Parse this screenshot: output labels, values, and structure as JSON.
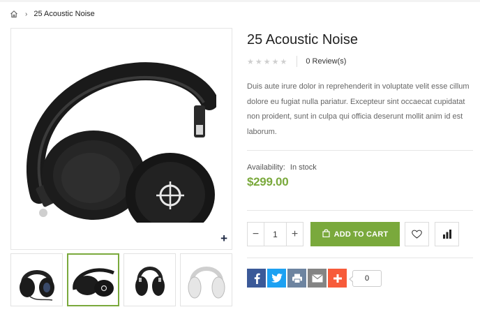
{
  "breadcrumb": {
    "home_icon": "home-icon",
    "separator": "›",
    "current": "25 Acoustic Noise"
  },
  "product": {
    "title": "25 Acoustic Noise",
    "rating": {
      "stars_filled": 0,
      "stars_total": 5,
      "reviews_label": "0 Review(s)"
    },
    "description": "Duis aute irure dolor in reprehenderit in voluptate velit esse cillum dolore eu fugiat nulla pariatur. Excepteur sint occaecat cupidatat non proident, sunt in culpa qui officia deserunt mollit anim id est laborum.",
    "availability_label": "Availability:",
    "availability_value": "In stock",
    "price": "$299.00"
  },
  "gallery": {
    "zoom_icon": "plus-icon",
    "active_thumbnail": 2,
    "thumbnail_count": 4
  },
  "purchase": {
    "quantity": "1",
    "minus_label": "−",
    "plus_label": "+",
    "add_to_cart_label": "Add to Cart",
    "wishlist_icon": "heart-icon",
    "compare_icon": "bar-chart-icon"
  },
  "share": {
    "buttons": [
      "facebook-icon",
      "twitter-icon",
      "print-icon",
      "email-icon",
      "plus-share-icon"
    ],
    "count": "0"
  },
  "colors": {
    "accent": "#7aa93c",
    "facebook": "#3b5998",
    "twitter": "#1da1f2",
    "print": "#6d84a0",
    "email": "#848484",
    "addthis": "#f75b3a"
  }
}
